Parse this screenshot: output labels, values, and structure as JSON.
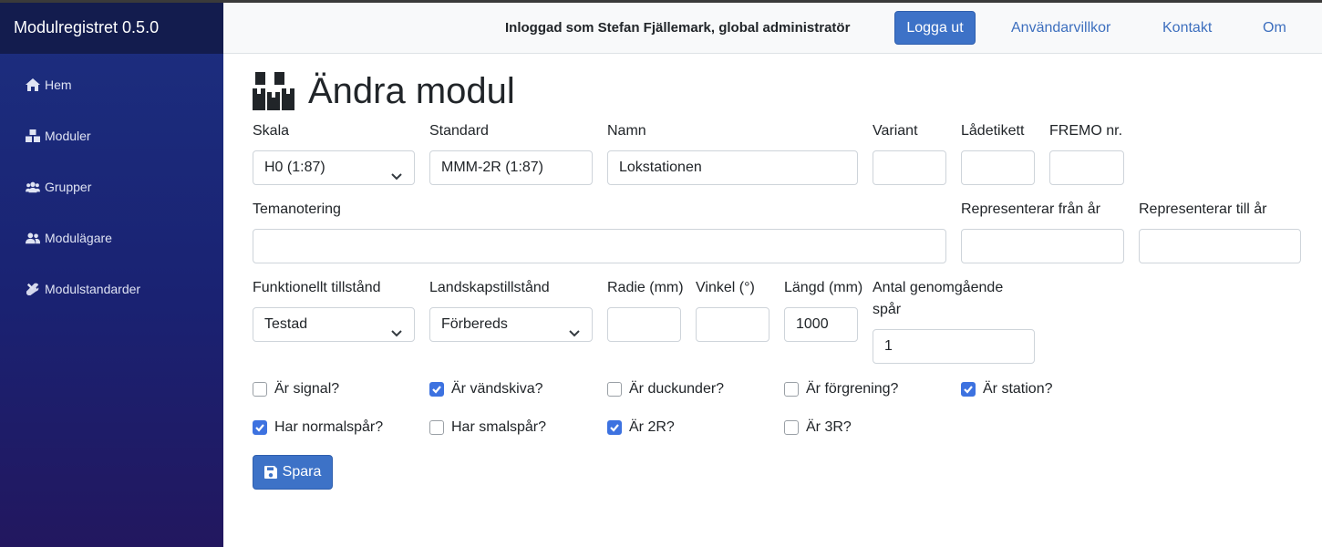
{
  "app": {
    "title": "Modulregistret 0.5.0"
  },
  "sidebar": {
    "items": [
      {
        "label": "Hem",
        "icon": "home-icon"
      },
      {
        "label": "Moduler",
        "icon": "boxes-icon"
      },
      {
        "label": "Grupper",
        "icon": "users-icon"
      },
      {
        "label": "Modulägare",
        "icon": "user-friends-icon"
      },
      {
        "label": "Modulstandarder",
        "icon": "tools-icon"
      }
    ]
  },
  "header": {
    "user_text": "Inloggad som Stefan Fjällemark, global administratör",
    "logout_label": "Logga ut",
    "links": [
      "Användarvillkor",
      "Kontakt",
      "Om"
    ]
  },
  "page": {
    "title": "Ändra modul"
  },
  "form": {
    "skala": {
      "label": "Skala",
      "value": "H0 (1:87)"
    },
    "standard": {
      "label": "Standard",
      "value": "MMM-2R (1:87)"
    },
    "namn": {
      "label": "Namn",
      "value": "Lokstationen"
    },
    "variant": {
      "label": "Variant",
      "value": ""
    },
    "ladetikett": {
      "label": "Lådetikett",
      "value": ""
    },
    "fremo": {
      "label": "FREMO nr.",
      "value": ""
    },
    "temanotering": {
      "label": "Temanotering",
      "value": ""
    },
    "fran_ar": {
      "label": "Representerar från år",
      "value": ""
    },
    "till_ar": {
      "label": "Representerar till år",
      "value": ""
    },
    "funktionellt": {
      "label": "Funktionellt tillstånd",
      "value": "Testad"
    },
    "landskap": {
      "label": "Landskapstillstånd",
      "value": "Förbereds"
    },
    "radie": {
      "label": "Radie (mm)",
      "value": ""
    },
    "vinkel": {
      "label": "Vinkel (°)",
      "value": ""
    },
    "langd": {
      "label": "Längd (mm)",
      "value": "1000"
    },
    "antal_spar": {
      "label_line1": "Antal genomgående",
      "label_line2": "spår",
      "value": "1"
    },
    "checkboxes": [
      {
        "label": "Är signal?",
        "checked": false
      },
      {
        "label": "Är vändskiva?",
        "checked": true
      },
      {
        "label": "Är duckunder?",
        "checked": false
      },
      {
        "label": "Är förgrening?",
        "checked": false
      },
      {
        "label": "Är station?",
        "checked": true
      },
      {
        "label": "Har normalspår?",
        "checked": true
      },
      {
        "label": "Har smalspår?",
        "checked": false
      },
      {
        "label": "Är 2R?",
        "checked": true
      },
      {
        "label": "Är 3R?",
        "checked": false
      }
    ],
    "save_label": "Spara"
  },
  "colors": {
    "sidebar_top": "#1c2f80",
    "sidebar_bottom": "#22175f",
    "primary": "#3d72c7",
    "link": "#3d6fbe"
  }
}
